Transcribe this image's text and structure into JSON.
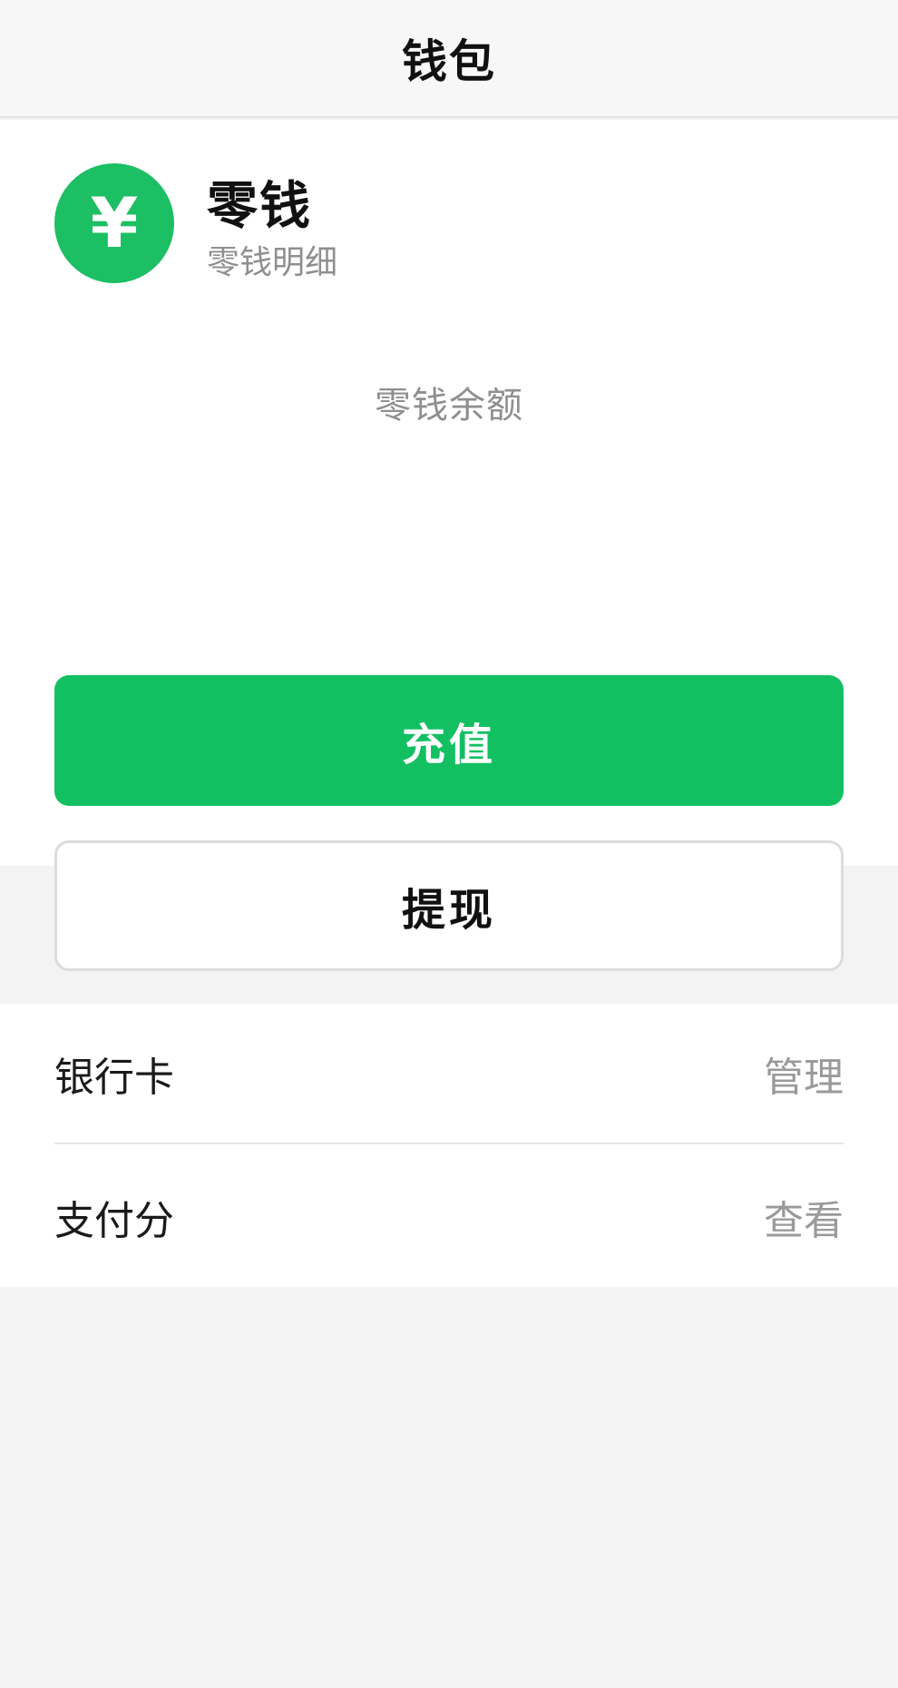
{
  "navbar": {
    "title": "钱包"
  },
  "wallet": {
    "icon": "yuan-coin-icon",
    "icon_glyph": "¥",
    "accent_color": "#1cbf63",
    "name": "零钱",
    "detail_link": "零钱明细",
    "balance_label": "零钱余额"
  },
  "actions": {
    "recharge_label": "充值",
    "withdraw_label": "提现"
  },
  "list": {
    "items": [
      {
        "label": "银行卡",
        "action": "管理"
      },
      {
        "label": "支付分",
        "action": "查看"
      }
    ]
  }
}
